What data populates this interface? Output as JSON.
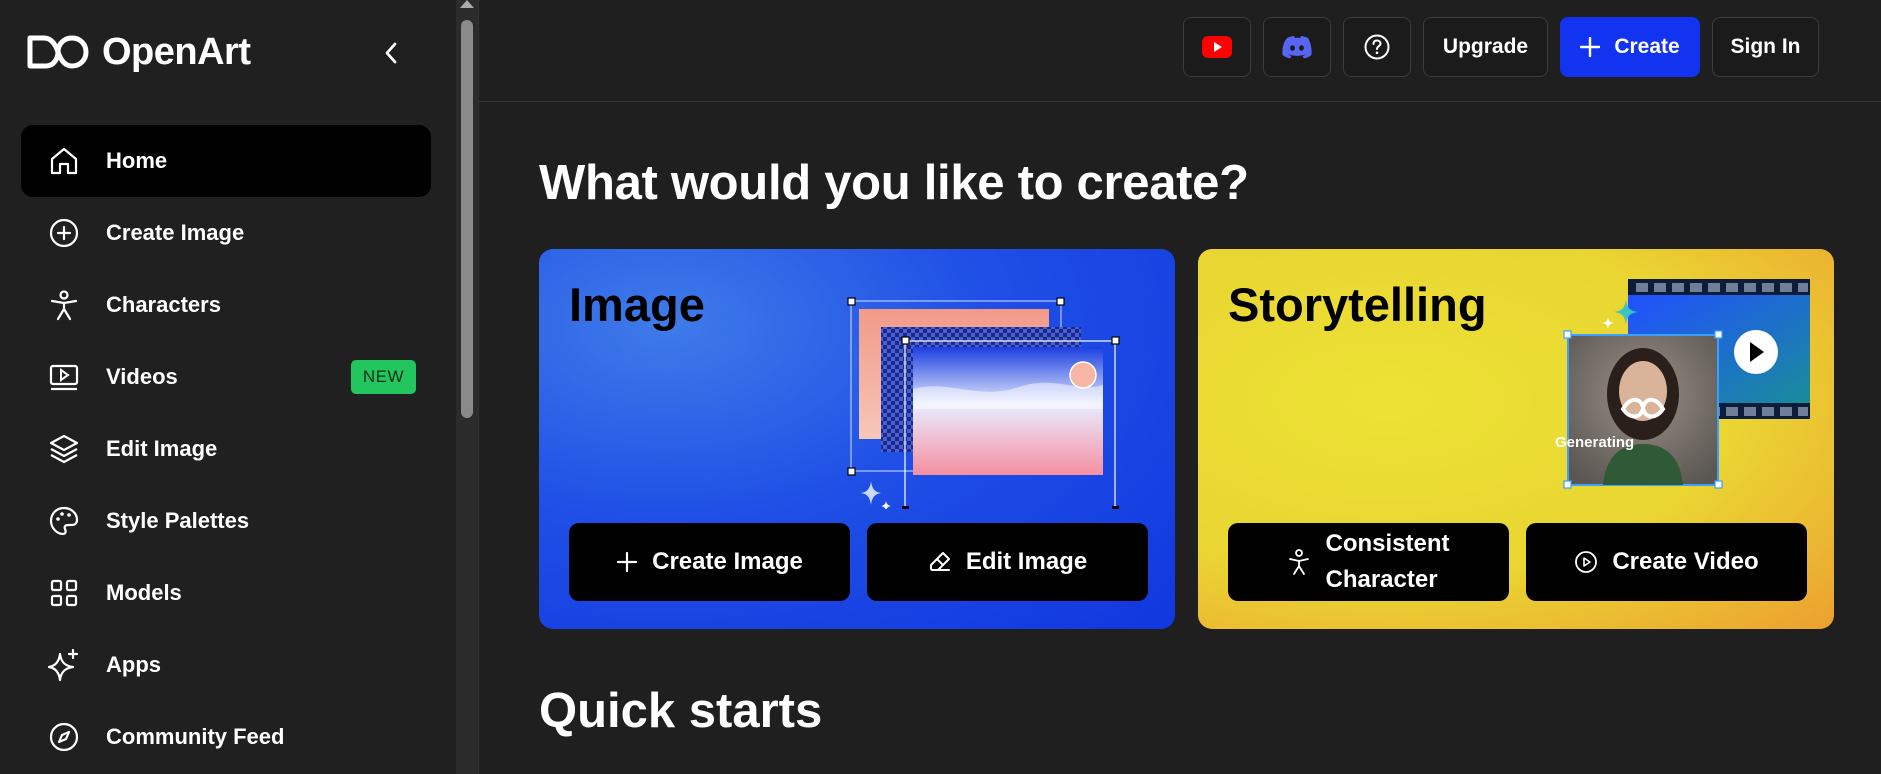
{
  "app": {
    "name": "OpenArt"
  },
  "sidebar": {
    "items": [
      {
        "label": "Home",
        "icon": "home-icon",
        "active": true
      },
      {
        "label": "Create Image",
        "icon": "plus-circle-icon"
      },
      {
        "label": "Characters",
        "icon": "person-icon"
      },
      {
        "label": "Videos",
        "icon": "video-icon",
        "badge": "NEW"
      },
      {
        "label": "Edit Image",
        "icon": "layers-icon"
      },
      {
        "label": "Style Palettes",
        "icon": "palette-icon"
      },
      {
        "label": "Models",
        "icon": "grid-icon"
      },
      {
        "label": "Apps",
        "icon": "sparkle-icon"
      },
      {
        "label": "Community Feed",
        "icon": "compass-icon"
      }
    ]
  },
  "topbar": {
    "upgrade_label": "Upgrade",
    "create_label": "Create",
    "signin_label": "Sign In"
  },
  "main": {
    "heading": "What would you like to create?",
    "cards": {
      "image": {
        "title": "Image",
        "button1": "Create Image",
        "button2": "Edit Image"
      },
      "story": {
        "title": "Storytelling",
        "button1_line1": "Consistent",
        "button1_line2": "Character",
        "button2": "Create Video",
        "generating_label": "Generating"
      }
    },
    "quick_starts": "Quick starts"
  },
  "colors": {
    "accent": "#1233f0",
    "badge_green": "#22c55e",
    "youtube_red": "#ff0000",
    "discord_blurple": "#5865f2"
  }
}
